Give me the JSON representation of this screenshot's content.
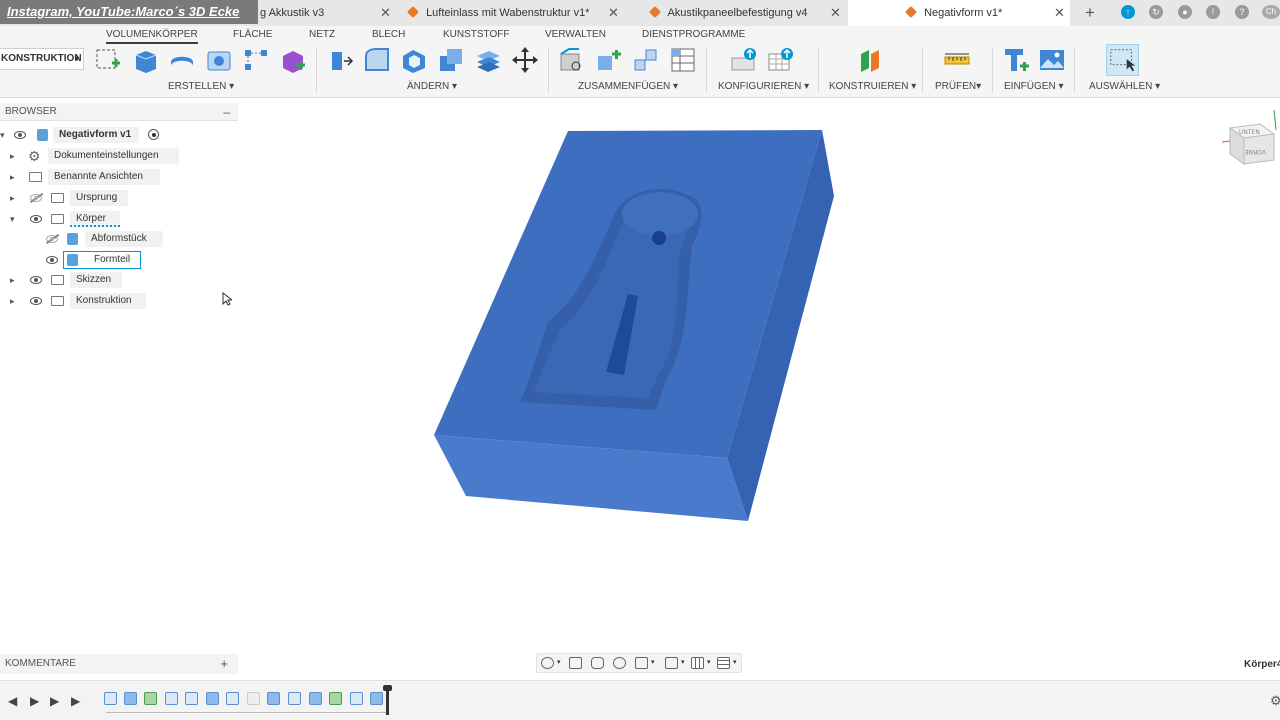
{
  "watermark": "Instagram, YouTube:Marco´s 3D Ecke",
  "tabs": [
    {
      "label": "g Akkustik v3",
      "active": false
    },
    {
      "label": "Lufteinlass mit Wabenstruktur v1*",
      "active": false
    },
    {
      "label": "Akustikpaneelbefestigung v4",
      "active": false
    },
    {
      "label": "Negativform v1*",
      "active": true
    }
  ],
  "tab_close": "✕",
  "tab_new": "+",
  "user_initials": "Ch",
  "workspace": "KONSTRUKTION",
  "toolbar_tabs": [
    "VOLUMENKÖRPER",
    "FLÄCHE",
    "NETZ",
    "BLECH",
    "KUNSTSTOFF",
    "VERWALTEN",
    "DIENSTPROGRAMME"
  ],
  "tool_groups": [
    "ERSTELLEN",
    "ÄNDERN",
    "ZUSAMMENFÜGEN",
    "KONFIGURIEREN",
    "KONSTRUIEREN",
    "PRÜFEN",
    "EINFÜGEN",
    "AUSWÄHLEN"
  ],
  "browser": {
    "title": "BROWSER",
    "collapse": "–",
    "root": "Negativform v1",
    "items": {
      "doc_settings": "Dokumenteinstellungen",
      "named_views": "Benannte Ansichten",
      "origin": "Ursprung",
      "bodies": "Körper",
      "body1": "Abformstück",
      "body2": "Formteil",
      "sketches": "Skizzen",
      "construction": "Konstruktion"
    }
  },
  "comments": {
    "title": "KOMMENTARE",
    "add": "+"
  },
  "viewcube": {
    "top": "UNTEN",
    "front": "VORNE",
    "axis": "X"
  },
  "status_right": "Körper4",
  "colors": {
    "model": "#3e6ec0",
    "model_side": "#3560ad",
    "accent": "#0696d7"
  }
}
